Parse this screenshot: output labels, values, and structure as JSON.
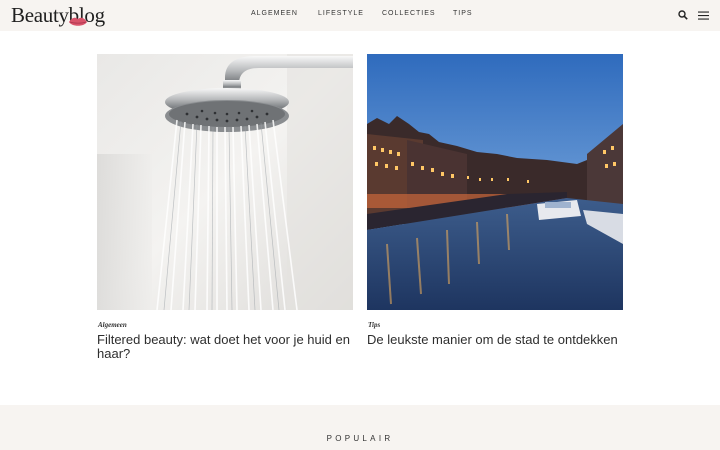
{
  "header": {
    "logo_text": "Beautyblog",
    "nav": [
      "ALGEMEEN",
      "LIFESTYLE",
      "COLLECTIES",
      "TIPS"
    ],
    "icons": [
      "search-icon",
      "hamburger-menu-icon",
      "lips-logo-icon"
    ]
  },
  "articles": [
    {
      "category": "Algemeen",
      "title": "Filtered beauty: wat doet het voor je huid en haar?",
      "image": "shower-head-photo"
    },
    {
      "category": "Tips",
      "title": "De leukste manier om de stad te ontdekken",
      "image": "canal-city-night-photo"
    }
  ],
  "popular": {
    "label": "POPULAIR"
  },
  "colors": {
    "header_bg": "#f7f4f1",
    "accent_lips": "#d9536a",
    "text": "#2e2e2e"
  }
}
